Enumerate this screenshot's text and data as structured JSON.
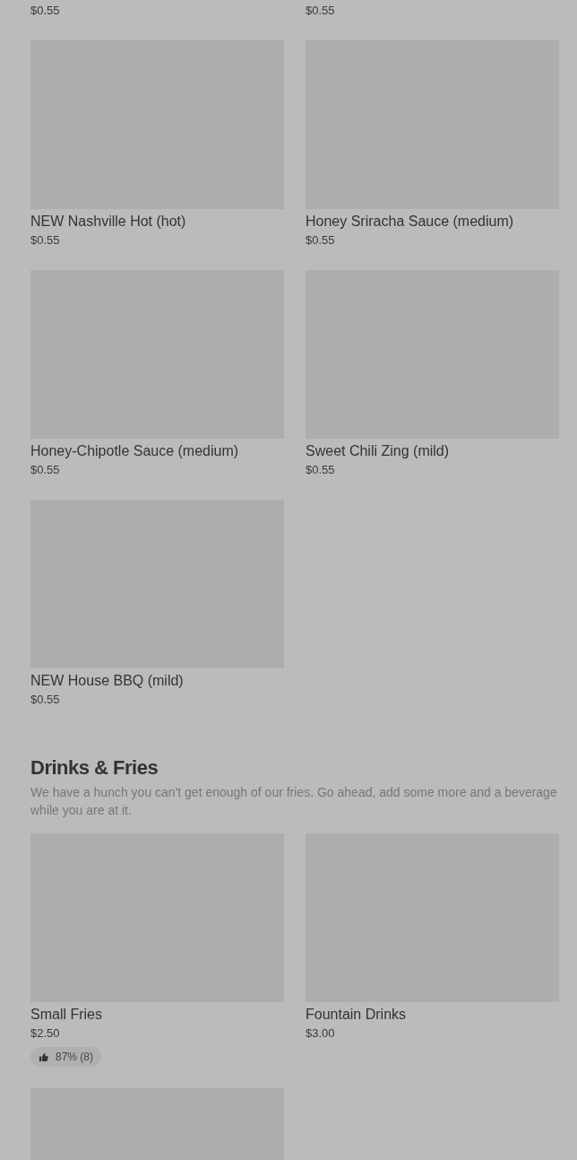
{
  "sections": [
    {
      "items": [
        {
          "image": false,
          "price": "$0.55"
        },
        {
          "image": false,
          "price": "$0.55"
        },
        {
          "image": true,
          "name": "NEW Nashville Hot (hot)",
          "price": "$0.55"
        },
        {
          "image": true,
          "name": "Honey Sriracha Sauce (medium)",
          "price": "$0.55"
        },
        {
          "image": true,
          "name": "Honey-Chipotle Sauce (medium)",
          "price": "$0.55"
        },
        {
          "image": true,
          "name": "Sweet Chili Zing (mild)",
          "price": "$0.55"
        },
        {
          "image": true,
          "name": "NEW House BBQ (mild)",
          "price": "$0.55"
        }
      ]
    },
    {
      "title": "Drinks & Fries",
      "description": "We have a hunch you can't get enough of our fries. Go ahead, add some more and a beverage while you are at it.",
      "items": [
        {
          "image": true,
          "name": "Small Fries",
          "price": "$2.50",
          "rating": "87% (8)"
        },
        {
          "image": true,
          "name": "Fountain Drinks",
          "price": "$3.00"
        },
        {
          "image": true
        }
      ]
    }
  ]
}
